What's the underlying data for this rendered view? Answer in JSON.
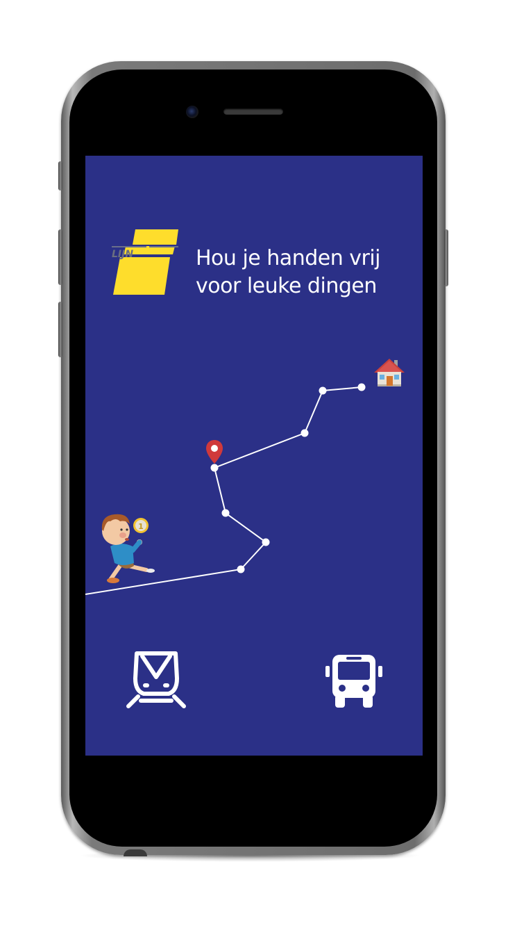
{
  "app": {
    "logo_text": "LIJN",
    "tagline_line1": "Hou je handen vrij",
    "tagline_line2": "voor leuke dingen"
  },
  "icons": {
    "logo": "de-lijn-logo",
    "destination": "house-icon",
    "location": "map-pin-icon",
    "illustration": "running-child-with-coin",
    "coin_label": "1",
    "train": "tram-icon",
    "bus": "bus-icon"
  },
  "colors": {
    "screen_background": "#2b3087",
    "logo_yellow": "#fedd2c",
    "route_line": "#ffffff",
    "pin_red": "#d0393b"
  }
}
